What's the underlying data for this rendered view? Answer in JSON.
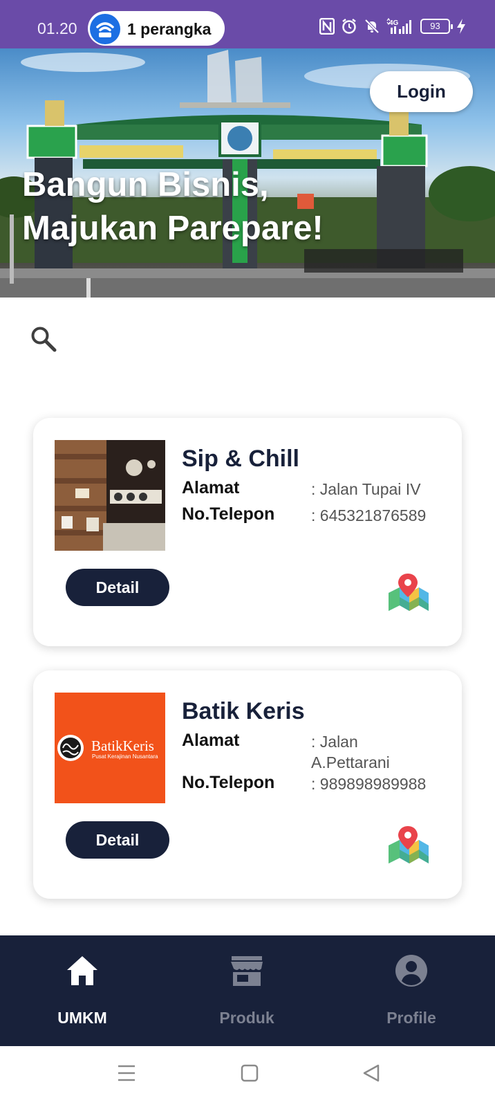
{
  "status_bar": {
    "time": "01.20",
    "hotspot_text": "1 perangka",
    "battery_level": "93",
    "background": "#6a4ba8"
  },
  "hero": {
    "title_line1": "Bangun Bisnis,",
    "title_line2": "Majukan Parepare!",
    "login_label": "Login"
  },
  "search": {
    "icon": "search-icon"
  },
  "umkm_list": [
    {
      "name": "Sip & Chill",
      "address_label": "Alamat",
      "address": ": Jalan Tupai IV",
      "phone_label": "No.Telepon",
      "phone": ": 645321876589",
      "detail_label": "Detail",
      "map_icon": "map-pin-icon"
    },
    {
      "name": "Batik Keris",
      "address_label": "Alamat",
      "address": ": Jalan A.Pettarani",
      "phone_label": "No.Telepon",
      "phone": ": 989898989988",
      "detail_label": "Detail",
      "map_icon": "map-pin-icon",
      "logo_text": "BatikKeris",
      "logo_subtext": "Pusat Kerajinan Nusantara",
      "logo_color": "#f2521a"
    }
  ],
  "bottom_nav": {
    "items": [
      {
        "label": "UMKM",
        "icon": "home-icon",
        "active": true
      },
      {
        "label": "Produk",
        "icon": "store-icon",
        "active": false
      },
      {
        "label": "Profile",
        "icon": "profile-icon",
        "active": false
      }
    ],
    "background": "#18213a"
  },
  "system_nav": {
    "icons": [
      "menu-icon",
      "home-square-icon",
      "back-icon"
    ]
  }
}
